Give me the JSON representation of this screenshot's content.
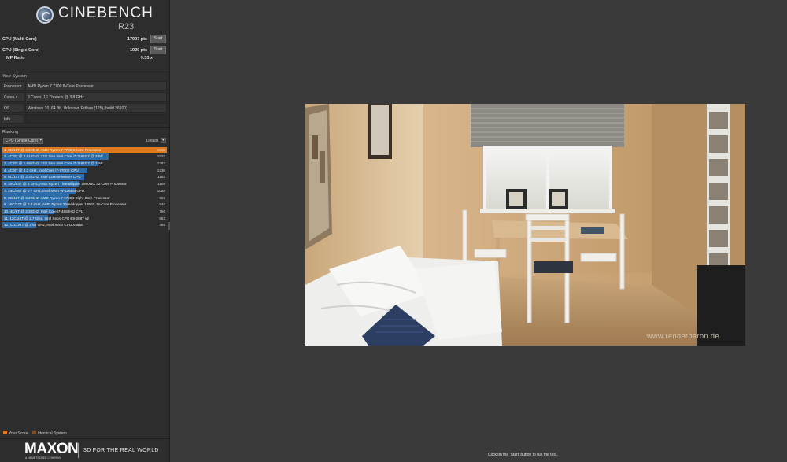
{
  "app": {
    "name": "CINEBENCH",
    "version": "R23"
  },
  "scores": [
    {
      "label": "CPU (Multi Core)",
      "value": "17907 pts",
      "button": "Start"
    },
    {
      "label": "CPU (Single Core)",
      "value": "1920 pts",
      "button": "Start"
    }
  ],
  "mp_ratio": {
    "label": "MP Ratio",
    "value": "9.33 x"
  },
  "your_system": {
    "title": "Your System",
    "rows": [
      {
        "key": "Processor",
        "value": "AMD Ryzen 7 7700 8-Core Processor"
      },
      {
        "key": "Cores x GHz",
        "value": "8 Cores, 16 Threads @ 3.8 GHz"
      },
      {
        "key": "OS",
        "value": "Windows 10, 64 Bit, Unknown Edition (125) (build 26100)"
      },
      {
        "key": "Info",
        "value": ""
      }
    ]
  },
  "ranking": {
    "title": "Ranking",
    "selected_test": "CPU (Single Core)",
    "details_label": "Details",
    "max_score": 1920,
    "rows": [
      {
        "label": "1. 8C/16T @ 3.8 GHz, AMD Ryzen 7 7700 8-Core Processor",
        "score": 1920,
        "score_text": "1920",
        "own": true
      },
      {
        "label": "2. 4C/8T @ 2.81 GHz, 11th Gen Intel Core i7-1165G7 @ 28W",
        "score": 1532,
        "score_text": "1532",
        "own": false
      },
      {
        "label": "3. 4C/8T @ 1.69 GHz, 11th Gen Intel Core i7-1165G7 @ 15W",
        "score": 1382,
        "score_text": "1382",
        "own": false
      },
      {
        "label": "4. 4C/8T @ 4.2 GHz, Intel Core i7-7700K CPU",
        "score": 1230,
        "score_text": "1230",
        "own": false
      },
      {
        "label": "5. 6C/14T @ 2.3 GHz, Intel Core i9-9880H CPU",
        "score": 1183,
        "score_text": "1183",
        "own": false
      },
      {
        "label": "6. 32C/64T @ 3 GHz, AMD Ryzen Threadripper 2990WX 32-Core Processor",
        "score": 1109,
        "score_text": "1109",
        "own": false
      },
      {
        "label": "7. 24C/48T @ 2.7 GHz, Intel Xeon W-3265M CPU",
        "score": 1058,
        "score_text": "1058",
        "own": false
      },
      {
        "label": "8. 8C/16T @ 3.4 GHz, AMD Ryzen 7 1700X Eight-Core Processor",
        "score": 959,
        "score_text": "959",
        "own": false
      },
      {
        "label": "9. 16C/32T @ 3.4 GHz, AMD Ryzen Threadripper 1950X 16-Core Processor",
        "score": 945,
        "score_text": "945",
        "own": false
      },
      {
        "label": "10. 4C/8T @ 2.3 GHz, Intel Core i7-4850HQ CPU",
        "score": 750,
        "score_text": "750",
        "own": false
      },
      {
        "label": "11. 12C/24T @ 2.7 GHz, Intel Xeon CPU E5-2697 v2",
        "score": 653,
        "score_text": "653",
        "own": false
      },
      {
        "label": "12. 12C/24T @ 2.66 GHz, Intel Xeon CPU X5650",
        "score": 486,
        "score_text": "486",
        "own": false
      }
    ]
  },
  "legend": {
    "your_score": "Your Score",
    "identical_system": "Identical System",
    "your_score_color": "#e07a1e",
    "identical_color": "#8a4a1a",
    "bar_color": "#2d6ca8"
  },
  "footer": {
    "brand": "MAXON",
    "brand_sub": "A NEMETSCHEK COMPANY",
    "tagline": "3D FOR THE REAL WORLD",
    "status": "Click on the 'Start' button to run the test."
  },
  "scene": {
    "watermark": "www.renderbaron.de"
  }
}
